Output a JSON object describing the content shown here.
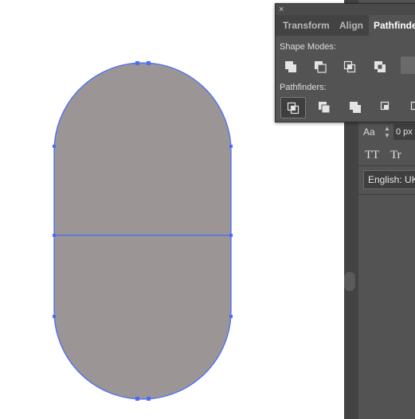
{
  "app": "Adobe Illustrator",
  "canvas": {
    "shape_fill": "#9b9695",
    "selection_color": "#4a6cf7",
    "background": "#ffffff"
  },
  "pathfinder_panel": {
    "close_symbol": "×",
    "tabs": [
      {
        "label": "Transform",
        "active": false
      },
      {
        "label": "Align",
        "active": false
      },
      {
        "label": "Pathfinder",
        "active": true
      }
    ],
    "shape_modes_label": "Shape Modes:",
    "shape_mode_icons": [
      "unite-icon",
      "minus-front-icon",
      "intersect-icon",
      "exclude-icon"
    ],
    "pathfinders_label": "Pathfinders:",
    "pathfinder_icons": [
      "divide-icon",
      "trim-icon",
      "merge-icon",
      "crop-icon",
      "outline-icon"
    ]
  },
  "character_panel": {
    "tracking_icon_label": "Aa",
    "tracking_value": "0 px",
    "all_caps_label": "TT",
    "small_caps_label": "Tr",
    "language": "English: UK"
  },
  "colors": {
    "panel_bg": "#535353",
    "tab_bar_bg": "#434343",
    "accent_active_tab_text": "#ffffff"
  }
}
